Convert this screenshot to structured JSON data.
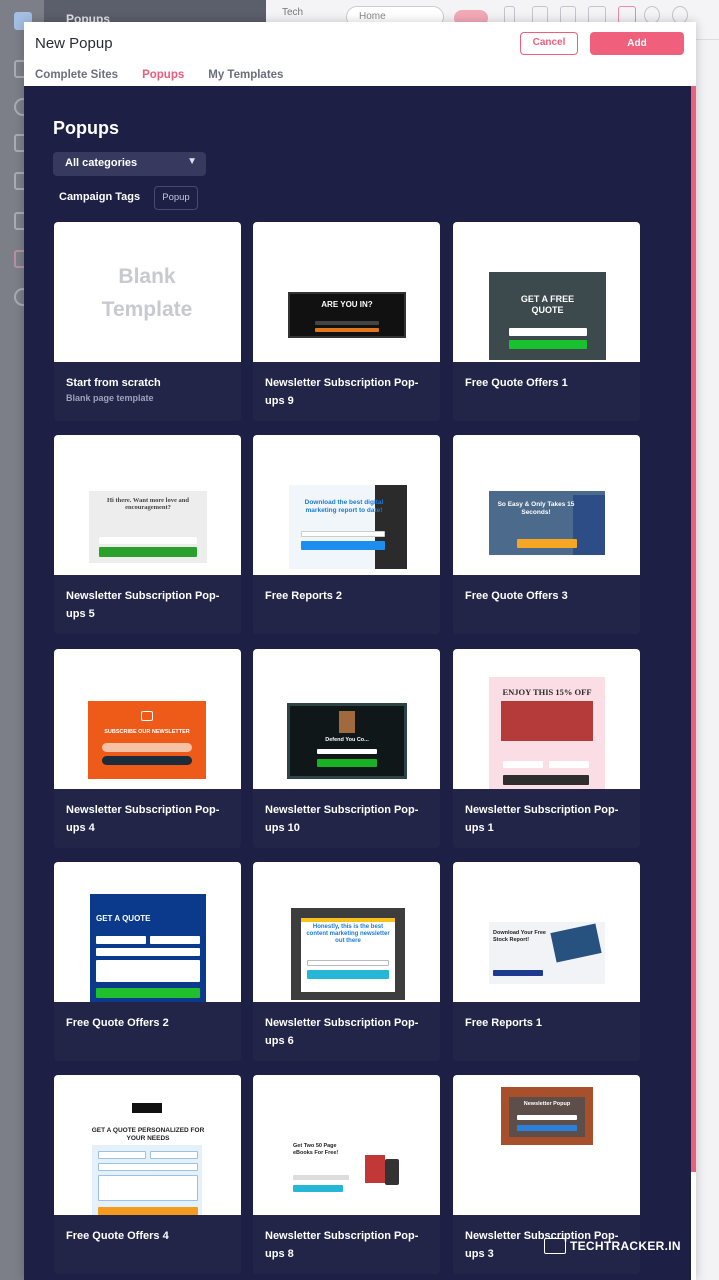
{
  "background": {
    "side_panel_title": "Popups",
    "workspace_name": "Tech",
    "page_select": "Home"
  },
  "modal": {
    "title": "New Popup",
    "cancel_label": "Cancel",
    "add_label": "Add",
    "tabs": [
      {
        "label": "Complete Sites",
        "active": false
      },
      {
        "label": "Popups",
        "active": true
      },
      {
        "label": "My Templates",
        "active": false
      }
    ]
  },
  "content": {
    "section_title": "Popups",
    "category_select": "All categories",
    "campaign_tags_label": "Campaign Tags",
    "tag_chip": "Popup",
    "templates": [
      {
        "title": "Start from scratch",
        "subtitle": "Blank page template",
        "thumb_text": "Blank Template"
      },
      {
        "title": "Newsletter Subscription Pop-ups 9",
        "thumb_text": "ARE YOU IN?"
      },
      {
        "title": "Free Quote Offers 1",
        "thumb_text": "GET A FREE QUOTE"
      },
      {
        "title": "Newsletter Subscription Pop-ups 5",
        "thumb_text": "Hi there. Want more love and encouragement?"
      },
      {
        "title": "Free Reports 2",
        "thumb_text": "Download the best digital marketing report to date!"
      },
      {
        "title": "Free Quote Offers 3",
        "thumb_text": "So Easy & Only Takes 15 Seconds!"
      },
      {
        "title": "Newsletter Subscription Pop-ups 4",
        "thumb_text": "SUBSCRIBE OUR NEWSLETTER"
      },
      {
        "title": "Newsletter Subscription Pop-ups 10",
        "thumb_text": "Defend You Co..."
      },
      {
        "title": "Newsletter Subscription Pop-ups 1",
        "thumb_text": "ENJOY THIS 15% OFF"
      },
      {
        "title": "Free Quote Offers 2",
        "thumb_text": "GET A QUOTE"
      },
      {
        "title": "Newsletter Subscription Pop-ups 6",
        "thumb_text": "Honestly, this is the best content marketing newsletter out there"
      },
      {
        "title": "Free Reports 1",
        "thumb_text": "Download Your Free Stock Report!"
      },
      {
        "title": "Free Quote Offers 4",
        "thumb_text": "GET A QUOTE PERSONALIZED FOR YOUR NEEDS"
      },
      {
        "title": "Newsletter Subscription Pop-ups 8",
        "thumb_text": "Get Two 50 Page eBooks For Free!"
      },
      {
        "title": "Newsletter Subscription Pop-ups 3",
        "thumb_text": "Newsletter Popup"
      }
    ]
  },
  "watermark": "TECHTRACKER.IN",
  "colors": {
    "accent": "#ef5f7c",
    "content_bg": "#1d1f45",
    "card_bg": "#222548"
  }
}
